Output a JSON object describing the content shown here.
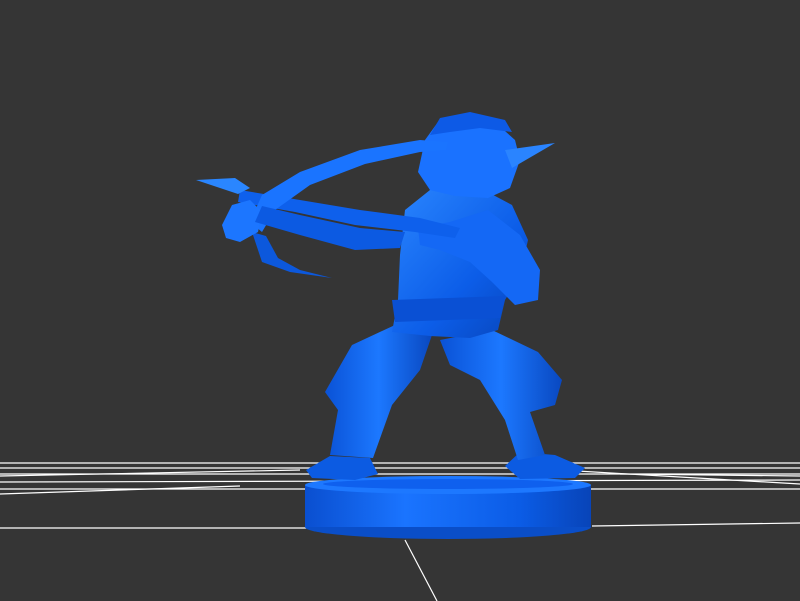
{
  "viewport": {
    "background": "#353535",
    "grid_color": "#ffffff",
    "model_color": "#0a66ff"
  },
  "scene": {
    "model": "archer-goblin-figurine",
    "base": "round-pedestal",
    "weapon": "crossbow"
  }
}
